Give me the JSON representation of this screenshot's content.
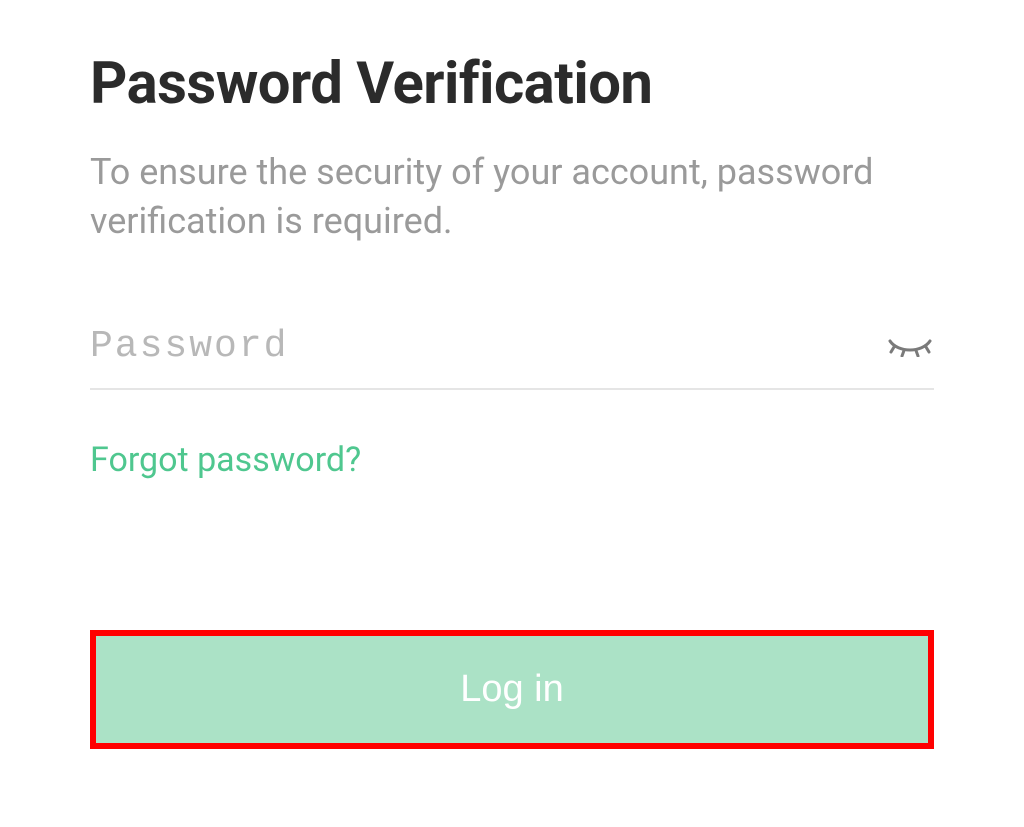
{
  "title": "Password Verification",
  "subtitle": "To ensure the security of your account, password verification is required.",
  "password": {
    "placeholder": "Password",
    "value": ""
  },
  "forgot_link": "Forgot password?",
  "login_button": "Log in",
  "colors": {
    "accent": "#4fc78f",
    "button_bg": "#abe2c6",
    "highlight_border": "#ff0000"
  }
}
